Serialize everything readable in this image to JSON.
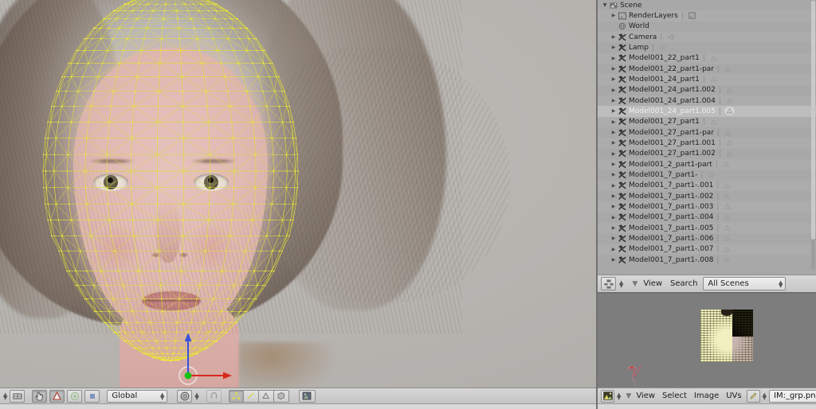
{
  "app": {
    "name": "Blender",
    "editors": [
      "3D View",
      "Outliner",
      "UV/Image Editor"
    ]
  },
  "viewport": {
    "name": "3d-viewport",
    "content_description": "Textured female head model with yellow editable wireframe overlay in Edit Mode",
    "manipulator": {
      "x_axis_color": "#e03020",
      "z_axis_color": "#3050e0",
      "origin_color": "#22cc22"
    },
    "wire_color": "#e8e23c",
    "face_tint": "#e0b9b3"
  },
  "viewport_footer": {
    "name": "3d-view-header",
    "editor_type_icon": "3d-view-icon",
    "buttons": [
      {
        "name": "transform-cursor-icon",
        "glyph": "☞",
        "state": "pressed"
      },
      {
        "name": "manipulator-translate-icon",
        "glyph": "△",
        "state": "pressed"
      },
      {
        "name": "manipulator-rotate-icon",
        "glyph": "◎",
        "state": "normal"
      },
      {
        "name": "manipulator-scale-icon",
        "glyph": "■",
        "state": "normal"
      }
    ],
    "orientation": {
      "label": "Global",
      "name": "transform-orientation-dropdown"
    },
    "pivot_icon": "pivot-median-point-icon",
    "snap_icon": "snap-magnet-icon",
    "snap_enabled": false,
    "mesh_select_modes": [
      {
        "name": "vertex-select-icon",
        "glyph": "∴",
        "state": "pressed"
      },
      {
        "name": "edge-select-icon",
        "glyph": "╱",
        "state": "normal"
      },
      {
        "name": "face-select-icon",
        "glyph": "△",
        "state": "normal"
      },
      {
        "name": "limit-selection-visible-icon",
        "glyph": "⬛",
        "state": "normal"
      }
    ],
    "shading_icon": "texture-shading-icon"
  },
  "outliner": {
    "name": "outliner-editor",
    "display_mode": "All Scenes",
    "rows": [
      {
        "indent": 0,
        "tri": "open",
        "icon": "scene-icon",
        "label": "Scene",
        "data": ""
      },
      {
        "indent": 1,
        "tri": "closed",
        "icon": "renderlayers-icon",
        "label": "RenderLayers",
        "data": "renderlayer-icon"
      },
      {
        "indent": 1,
        "tri": "none",
        "icon": "world-icon",
        "label": "World",
        "data": ""
      },
      {
        "indent": 1,
        "tri": "closed",
        "icon": "object-icon",
        "label": "Camera",
        "data": "camera-icon"
      },
      {
        "indent": 1,
        "tri": "closed",
        "icon": "object-icon",
        "label": "Lamp",
        "data": "lamp-icon"
      },
      {
        "indent": 1,
        "tri": "closed",
        "icon": "object-icon",
        "label": "Model001_22_part1",
        "data": "mesh-icon"
      },
      {
        "indent": 1,
        "tri": "closed",
        "icon": "object-icon",
        "label": "Model001_22_part1-par",
        "data": "mesh-icon"
      },
      {
        "indent": 1,
        "tri": "closed",
        "icon": "object-icon",
        "label": "Model001_24_part1",
        "data": "mesh-icon"
      },
      {
        "indent": 1,
        "tri": "closed",
        "icon": "object-icon",
        "label": "Model001_24_part1.002",
        "data": "mesh-icon"
      },
      {
        "indent": 1,
        "tri": "closed",
        "icon": "object-icon",
        "label": "Model001_24_part1.004",
        "data": "mesh-icon"
      },
      {
        "indent": 1,
        "tri": "closed",
        "icon": "object-icon",
        "label": "Model001_24_part1.005",
        "data": "mesh-icon",
        "selected": true
      },
      {
        "indent": 1,
        "tri": "closed",
        "icon": "object-icon",
        "label": "Model001_27_part1",
        "data": "mesh-icon"
      },
      {
        "indent": 1,
        "tri": "closed",
        "icon": "object-icon",
        "label": "Model001_27_part1-par",
        "data": "mesh-icon"
      },
      {
        "indent": 1,
        "tri": "closed",
        "icon": "object-icon",
        "label": "Model001_27_part1.001",
        "data": "mesh-icon"
      },
      {
        "indent": 1,
        "tri": "closed",
        "icon": "object-icon",
        "label": "Model001_27_part1.002",
        "data": "mesh-icon"
      },
      {
        "indent": 1,
        "tri": "closed",
        "icon": "object-icon",
        "label": "Model001_2_part1-part",
        "data": "mesh-icon"
      },
      {
        "indent": 1,
        "tri": "closed",
        "icon": "object-icon",
        "label": "Model001_7_part1-",
        "data": "mesh-icon"
      },
      {
        "indent": 1,
        "tri": "closed",
        "icon": "object-icon",
        "label": "Model001_7_part1-.001",
        "data": "mesh-icon"
      },
      {
        "indent": 1,
        "tri": "closed",
        "icon": "object-icon",
        "label": "Model001_7_part1-.002",
        "data": "mesh-icon"
      },
      {
        "indent": 1,
        "tri": "closed",
        "icon": "object-icon",
        "label": "Model001_7_part1-.003",
        "data": "mesh-icon"
      },
      {
        "indent": 1,
        "tri": "closed",
        "icon": "object-icon",
        "label": "Model001_7_part1-.004",
        "data": "mesh-icon"
      },
      {
        "indent": 1,
        "tri": "closed",
        "icon": "object-icon",
        "label": "Model001_7_part1-.005",
        "data": "mesh-icon"
      },
      {
        "indent": 1,
        "tri": "closed",
        "icon": "object-icon",
        "label": "Model001_7_part1-.006",
        "data": "mesh-icon"
      },
      {
        "indent": 1,
        "tri": "closed",
        "icon": "object-icon",
        "label": "Model001_7_part1-.007",
        "data": "mesh-icon"
      },
      {
        "indent": 1,
        "tri": "closed",
        "icon": "object-icon",
        "label": "Model001_7_part1-.008",
        "data": "mesh-icon"
      }
    ]
  },
  "outliner_footer": {
    "name": "outliner-header",
    "editor_type_icon": "outliner-icon",
    "menus": [
      "View",
      "Search"
    ],
    "display_mode_label": "All Scenes"
  },
  "image_editor": {
    "name": "uv-image-editor",
    "image_name": "IM:_grp.png",
    "background_color": "#7d7d7d",
    "uv_overlay": "sparse yellow UV island cluster with stray red-pink UV shell at lower-left"
  },
  "image_editor_footer": {
    "name": "uv-image-editor-header",
    "editor_type_icon": "uv-image-editor-icon",
    "menus": [
      "View",
      "Select",
      "Image",
      "UVs"
    ],
    "paint_icon": "brush-icon",
    "image_field_value": "IM:_grp.png"
  }
}
